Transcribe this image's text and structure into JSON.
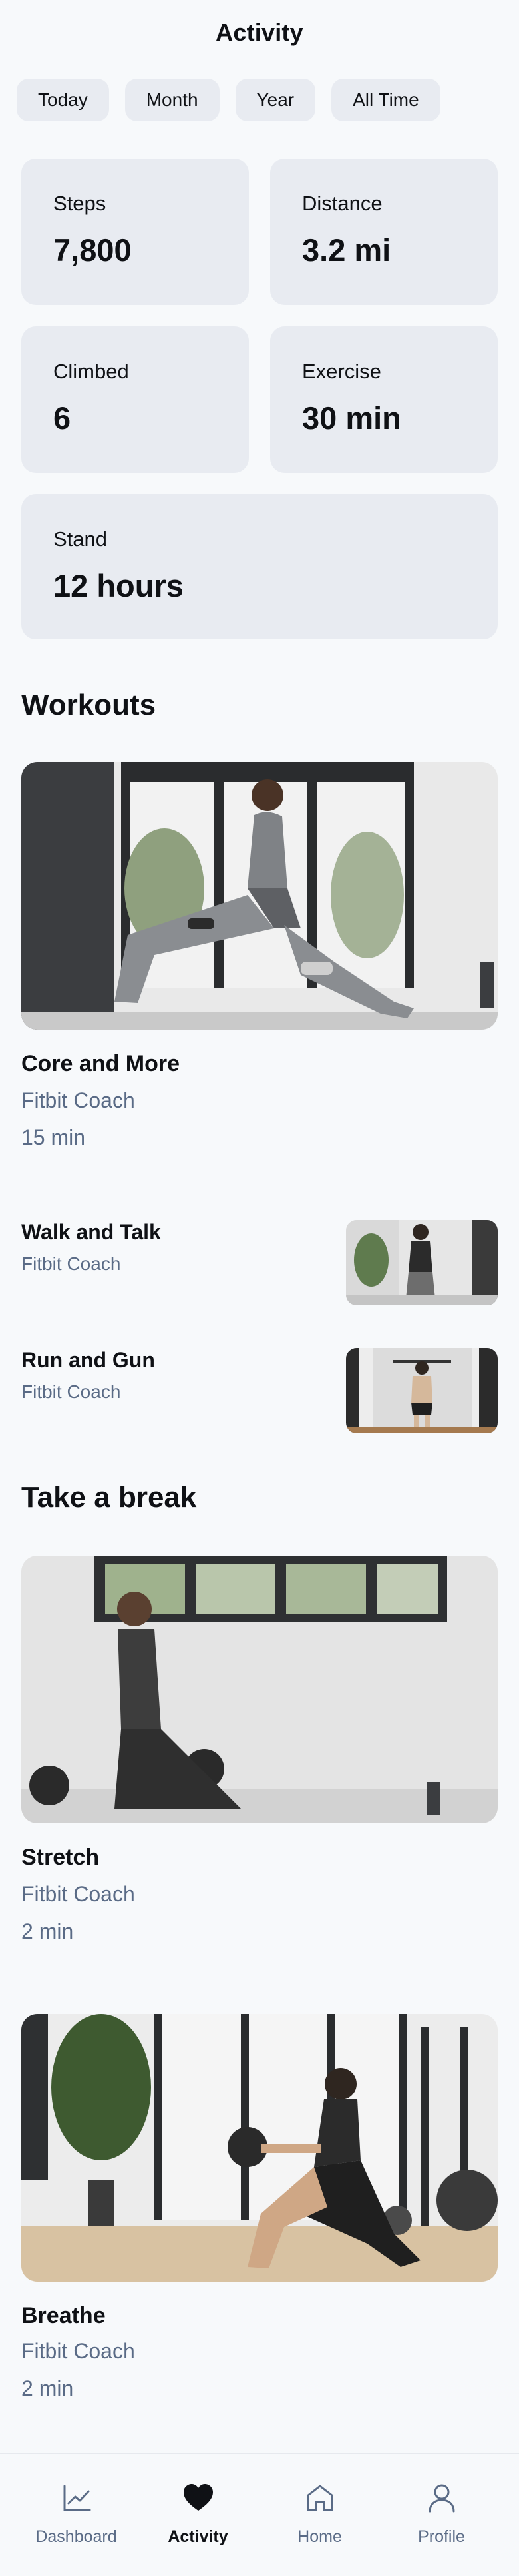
{
  "header": {
    "title": "Activity"
  },
  "filters": [
    "Today",
    "Month",
    "Year",
    "All Time"
  ],
  "stats": [
    {
      "label": "Steps",
      "value": "7,800"
    },
    {
      "label": "Distance",
      "value": "3.2 mi"
    },
    {
      "label": "Climbed",
      "value": "6"
    },
    {
      "label": "Exercise",
      "value": "30 min"
    },
    {
      "label": "Stand",
      "value": "12 hours"
    }
  ],
  "workouts": {
    "title": "Workouts",
    "featured": {
      "title": "Core and More",
      "coach": "Fitbit Coach",
      "duration": "15 min"
    },
    "list": [
      {
        "title": "Walk and Talk",
        "coach": "Fitbit Coach"
      },
      {
        "title": "Run and Gun",
        "coach": "Fitbit Coach"
      }
    ]
  },
  "break": {
    "title": "Take a break",
    "items": [
      {
        "title": "Stretch",
        "coach": "Fitbit Coach",
        "duration": "2 min"
      },
      {
        "title": "Breathe",
        "coach": "Fitbit Coach",
        "duration": "2 min"
      }
    ]
  },
  "nav": {
    "items": [
      {
        "label": "Dashboard",
        "icon": "chart-line-icon"
      },
      {
        "label": "Activity",
        "icon": "heart-icon"
      },
      {
        "label": "Home",
        "icon": "home-icon"
      },
      {
        "label": "Profile",
        "icon": "user-icon"
      }
    ],
    "active": "Activity"
  },
  "colors": {
    "background": "#f7f9fb",
    "card": "#e8ebf1",
    "text": "#0f1115",
    "secondary_text": "#5a6b86"
  }
}
